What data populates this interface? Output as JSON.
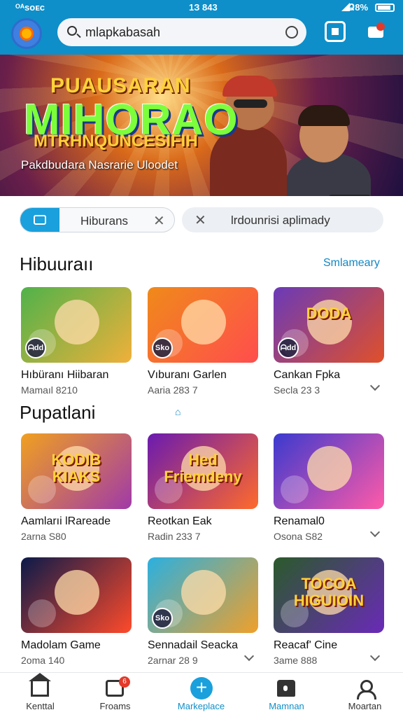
{
  "status_bar": {
    "carrier": "ᴼᴬsoᴇᴄ",
    "time": "1З 843",
    "battery": "Ձ8%"
  },
  "header": {
    "search": {
      "value": "mlapkabasah"
    }
  },
  "banner": {
    "title_top": "PUAUSARAN",
    "title_main": "MIHORAO",
    "title_sub": "MTRHNQUNCESIFIH",
    "caption": "Pakdbudara Nasrarie Uloodet"
  },
  "filters": [
    {
      "label": "Hiburans",
      "active": true
    },
    {
      "label": "lrdounrisi aplimady",
      "active": false
    }
  ],
  "sections": {
    "first": {
      "title": "Hibuuraıı",
      "link": "Smlameary"
    },
    "second": {
      "title": "Pupatlani"
    }
  },
  "cards": [
    {
      "title": "Hıbüranı Hiibaran",
      "sub": "Mamaıl 8210",
      "badge": "ᗩdd",
      "colors": [
        "#4fb24a",
        "#f0b03a"
      ],
      "word": ""
    },
    {
      "title": "Vıburanı Garlen",
      "sub": "Aaria 283 7",
      "badge": "Sko",
      "colors": [
        "#f08a1a",
        "#ff4d4d"
      ],
      "word": ""
    },
    {
      "title": "Cankan Fpka",
      "sub": "Secla 23 3",
      "badge": "ᗩdd",
      "colors": [
        "#6a3ab8",
        "#e0502a"
      ],
      "word": "DODA"
    },
    {
      "title": "Aamlarıi lRareade",
      "sub": "2arna S80",
      "badge": "",
      "colors": [
        "#f0a020",
        "#a03aa8"
      ],
      "word": "KODIB KIAKS"
    },
    {
      "title": "Reotkan Eak",
      "sub": "Radin 233 7",
      "badge": "",
      "colors": [
        "#6a1ab0",
        "#ff6a2a"
      ],
      "word": "Hed Friemdeny"
    },
    {
      "title": "Renamal0",
      "sub": "Osona S82",
      "badge": "",
      "colors": [
        "#3a3acf",
        "#ff5aa8"
      ],
      "word": ""
    },
    {
      "title": "Madolam Game",
      "sub": "2oma 140",
      "badge": "",
      "colors": [
        "#0a1a4a",
        "#ff4a2a"
      ],
      "word": ""
    },
    {
      "title": "Sennadail Seacka",
      "sub": "2arnar 28 9",
      "badge": "Sko",
      "colors": [
        "#2ab0e0",
        "#f0a02a"
      ],
      "word": ""
    },
    {
      "title": "Reacaf' Cine",
      "sub": "3ame 888",
      "badge": "",
      "colors": [
        "#2a5a2a",
        "#6a2ab8"
      ],
      "word": "TOCOA HIGUIOIN"
    }
  ],
  "bottom_nav": [
    {
      "label": "Kenttal",
      "icon": "home-icon",
      "active": false
    },
    {
      "label": "Froams",
      "icon": "inbox-icon",
      "badge": "6",
      "active": false
    },
    {
      "label": "Markeplace",
      "icon": "plus-icon",
      "active": true
    },
    {
      "label": "Mamnan",
      "icon": "shop-icon",
      "active": true
    },
    {
      "label": "Moartan",
      "icon": "user-icon",
      "active": false
    }
  ],
  "colors": {
    "primary": "#0e8fc9",
    "accent": "#1aa0dc",
    "badge_red": "#e43a2b"
  }
}
